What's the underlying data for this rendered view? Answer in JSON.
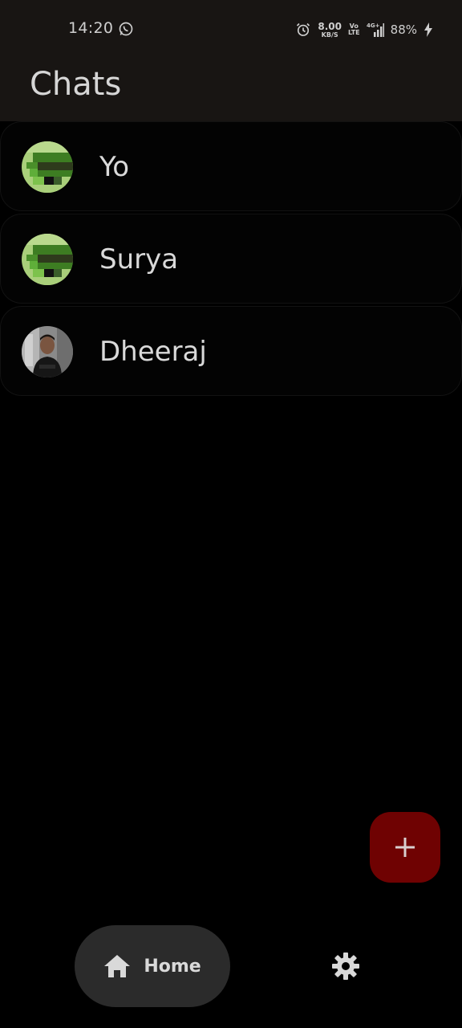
{
  "status_bar": {
    "time": "14:20",
    "network_speed_value": "8.00",
    "network_speed_unit": "KB/S",
    "volte_top": "Vo",
    "volte_bottom": "LTE",
    "network_type": "4G+",
    "battery_percent": "88%",
    "icons": [
      "whatsapp-icon",
      "alarm-icon",
      "signal-icon",
      "charging-bolt-icon"
    ]
  },
  "app_bar": {
    "title": "Chats"
  },
  "chats": [
    {
      "name": "Yo",
      "avatar": "pixel-art-avatar"
    },
    {
      "name": "Surya",
      "avatar": "pixel-art-avatar"
    },
    {
      "name": "Dheeraj",
      "avatar": "photo-avatar"
    }
  ],
  "fab": {
    "icon": "plus-icon",
    "color": "#6f0202"
  },
  "bottom_nav": {
    "home_label": "Home",
    "home_icon": "home-icon",
    "settings_icon": "gear-icon"
  },
  "colors": {
    "background": "#000000",
    "app_bar": "#181513",
    "nav_active_pill": "#2b2b2b",
    "text": "#d9d9d9"
  }
}
